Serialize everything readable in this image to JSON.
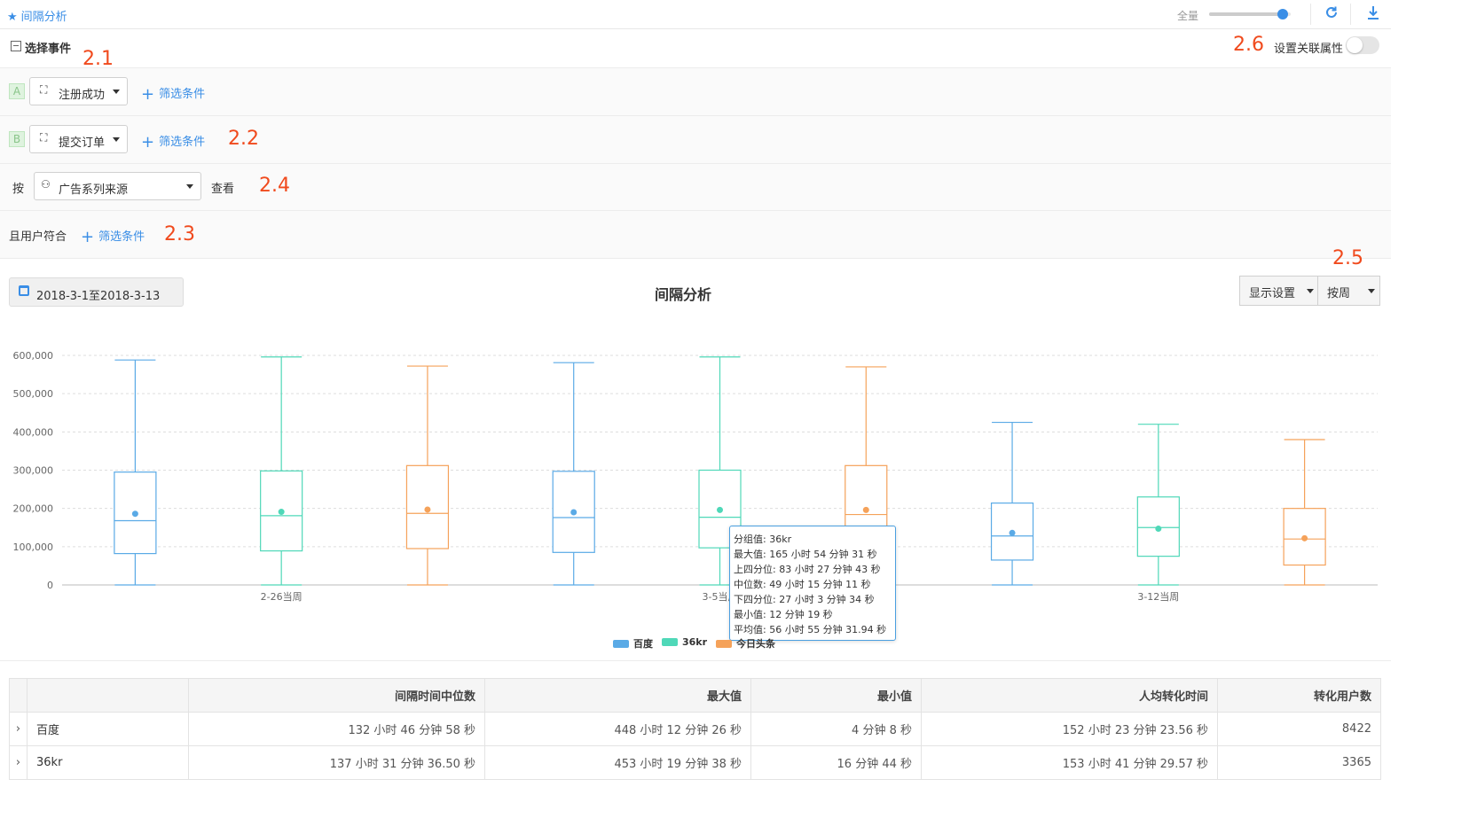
{
  "topbar": {
    "title": "间隔分析",
    "zoom_label": "全量",
    "zoom_level": 0.9
  },
  "events_header": {
    "label": "选择事件",
    "relation_label": "设置关联属性",
    "relation_enabled": false
  },
  "event_a": {
    "badge": "A",
    "event": "注册成功",
    "filter_label": "筛选条件"
  },
  "event_b": {
    "badge": "B",
    "event": "提交订单",
    "filter_label": "筛选条件"
  },
  "group_by": {
    "prefix": "按",
    "value": "广告系列来源",
    "suffix": "查看"
  },
  "user_filter": {
    "label": "且用户符合",
    "filter_label": "筛选条件"
  },
  "annotations": {
    "a1": "2.1",
    "a2": "2.2",
    "a3": "2.3",
    "a4": "2.4",
    "a5": "2.5",
    "a6": "2.6"
  },
  "date_range": "2018-3-1至2018-3-13",
  "chart_title": "间隔分析",
  "display_settings": "显示设置",
  "granularity": "按周",
  "colors": {
    "百度": "#5aaae6",
    "36kr": "#4fd8b8",
    "今日头条": "#f5a25a",
    "accent": "#3a8ee6",
    "annotation": "#f04a1d"
  },
  "chart_data": {
    "type": "boxplot",
    "categories": [
      "2-26当周",
      "3-5当周",
      "3-12当周"
    ],
    "ylim": [
      0,
      600000
    ],
    "yticks": [
      0,
      100000,
      200000,
      300000,
      400000,
      500000,
      600000
    ],
    "grid": true,
    "legend_position": "bottom",
    "series": [
      {
        "name": "百度",
        "boxes": [
          {
            "min": 0,
            "q1": 82000,
            "median": 168000,
            "q3": 295000,
            "max": 588000,
            "mean": 186000
          },
          {
            "min": 0,
            "q1": 85000,
            "median": 176000,
            "q3": 297000,
            "max": 581000,
            "mean": 190000
          },
          {
            "min": 0,
            "q1": 65000,
            "median": 128000,
            "q3": 214000,
            "max": 425000,
            "mean": 136000
          }
        ]
      },
      {
        "name": "36kr",
        "boxes": [
          {
            "min": 0,
            "q1": 89000,
            "median": 181000,
            "q3": 298000,
            "max": 596000,
            "mean": 191000
          },
          {
            "min": 0,
            "q1": 97000,
            "median": 177000,
            "q3": 300000,
            "max": 596000,
            "mean": 196000
          },
          {
            "min": 0,
            "q1": 75000,
            "median": 150000,
            "q3": 230000,
            "max": 420000,
            "mean": 147000
          }
        ]
      },
      {
        "name": "今日头条",
        "boxes": [
          {
            "min": 0,
            "q1": 95000,
            "median": 187000,
            "q3": 312000,
            "max": 572000,
            "mean": 197000
          },
          {
            "min": 0,
            "q1": 96000,
            "median": 184000,
            "q3": 312000,
            "max": 570000,
            "mean": 196000
          },
          {
            "min": 0,
            "q1": 52000,
            "median": 120000,
            "q3": 200000,
            "max": 380000,
            "mean": 122000
          }
        ]
      }
    ]
  },
  "tooltip": {
    "lines": [
      "分组值: 36kr",
      "最大值: 165 小时 54 分钟 31 秒",
      "上四分位: 83 小时 27 分钟 43 秒",
      "中位数: 49 小时 15 分钟 11 秒",
      "下四分位: 27 小时 3 分钟 34 秒",
      "最小值: 12 分钟 19 秒",
      "平均值: 56 小时 55 分钟 31.94 秒"
    ]
  },
  "table": {
    "headers": [
      "",
      "",
      "间隔时间中位数",
      "最大值",
      "最小值",
      "人均转化时间",
      "转化用户数"
    ],
    "rows": [
      {
        "name": "百度",
        "median": "132 小时 46 分钟 58 秒",
        "max": "448 小时 12 分钟 26 秒",
        "min": "4 分钟 8 秒",
        "avg": "152 小时 23 分钟 23.56 秒",
        "users": "8422"
      },
      {
        "name": "36kr",
        "median": "137 小时 31 分钟 36.50 秒",
        "max": "453 小时 19 分钟 38 秒",
        "min": "16 分钟 44 秒",
        "avg": "153 小时 41 分钟 29.57 秒",
        "users": "3365"
      }
    ]
  }
}
